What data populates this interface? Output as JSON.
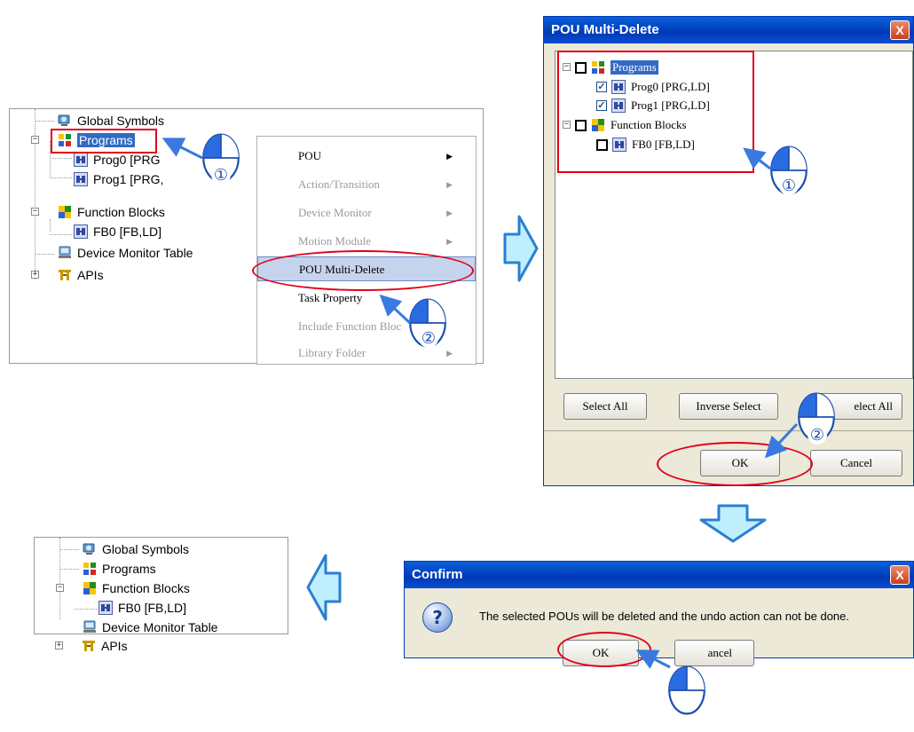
{
  "tree_before": {
    "global_symbols": "Global Symbols",
    "programs": "Programs",
    "prog0": "Prog0 [PRG",
    "prog1": "Prog1 [PRG,",
    "function_blocks": "Function Blocks",
    "fb0": "FB0 [FB,LD]",
    "device_monitor_table": "Device Monitor Table",
    "apis": "APIs"
  },
  "context_menu": {
    "items": [
      {
        "label": "POU",
        "enabled": true,
        "submenu": true
      },
      {
        "label": "Action/Transition",
        "enabled": false,
        "submenu": true
      },
      {
        "label": "Device Monitor",
        "enabled": false,
        "submenu": true
      },
      {
        "label": "Motion Module",
        "enabled": false,
        "submenu": true
      },
      {
        "label": "POU Multi-Delete",
        "enabled": true,
        "submenu": false
      },
      {
        "label": "Task Property",
        "enabled": true,
        "submenu": false
      },
      {
        "label": "Include Function Bloc",
        "enabled": false,
        "submenu": false
      },
      {
        "label": "Library Folder",
        "enabled": false,
        "submenu": true
      }
    ]
  },
  "multi_delete_dialog": {
    "title": "POU Multi-Delete",
    "close": "X",
    "programs": "Programs",
    "prog0": "Prog0 [PRG,LD]",
    "prog1": "Prog1 [PRG,LD]",
    "function_blocks": "Function Blocks",
    "fb0": "FB0 [FB,LD]",
    "select_all": "Select All",
    "inverse_select": "Inverse Select",
    "deselect_all": "elect All",
    "ok": "OK",
    "cancel": "Cancel"
  },
  "confirm_dialog": {
    "title": "Confirm",
    "close": "X",
    "message": "The selected POUs will be deleted and the undo action can not be done.",
    "ok": "OK",
    "cancel": "ancel",
    "question_mark": "?"
  },
  "tree_after": {
    "global_symbols": "Global Symbols",
    "programs": "Programs",
    "function_blocks": "Function Blocks",
    "fb0": "FB0 [FB,LD]",
    "device_monitor_table": "Device Monitor Table",
    "apis": "APIs"
  },
  "step_markers": {
    "one": "①",
    "two": "②"
  },
  "tree_expanders": {
    "minus": "−",
    "plus": "+"
  },
  "colors": {
    "highlight_red": "#e0001b",
    "arrow_fill": "#bfefff",
    "arrow_stroke": "#2a7fd4",
    "pointer_blue": "#3a7ae0",
    "title_bar": "#0039b8",
    "dialog_bg": "#ece9d8"
  }
}
